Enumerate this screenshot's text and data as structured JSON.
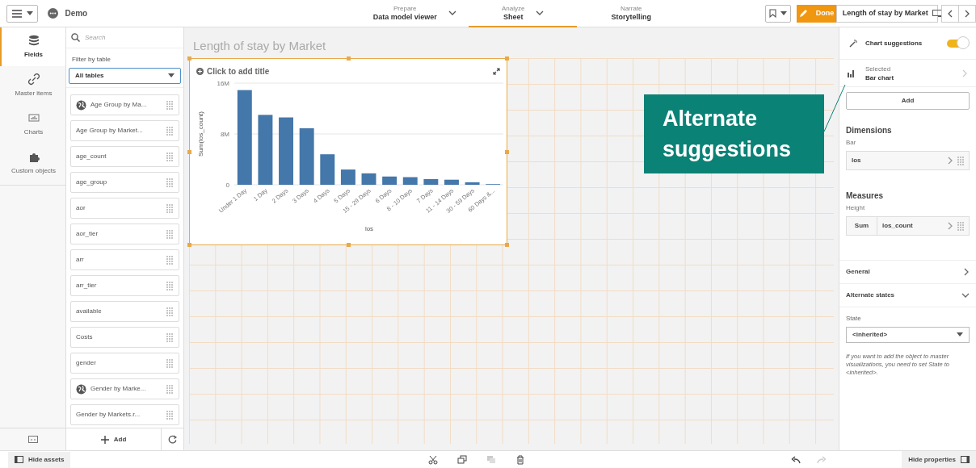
{
  "app": {
    "name": "Demo"
  },
  "nav_tabs": [
    {
      "stage": "Prepare",
      "label": "Data model viewer",
      "selected": false,
      "has_menu": true
    },
    {
      "stage": "Analyze",
      "label": "Sheet",
      "selected": true,
      "has_menu": true
    },
    {
      "stage": "Narrate",
      "label": "Storytelling",
      "selected": false,
      "has_menu": false
    }
  ],
  "toolbar": {
    "done": "Done",
    "sheet_title": "Length of stay by Market"
  },
  "asset_tabs": [
    {
      "label": "Fields",
      "kind": "fields",
      "selected": true
    },
    {
      "label": "Master items",
      "kind": "master",
      "selected": false
    },
    {
      "label": "Charts",
      "kind": "charts",
      "selected": false
    },
    {
      "label": "Custom objects",
      "kind": "custom",
      "selected": false
    }
  ],
  "fields_panel": {
    "search_placeholder": "Search",
    "filter_label": "Filter by table",
    "filter_value": "All tables",
    "fields": [
      {
        "label": "Age Group by Ma...",
        "kind": "geo"
      },
      {
        "label": "Age Group by Market...",
        "kind": "plain"
      },
      {
        "label": "age_count",
        "kind": "plain"
      },
      {
        "label": "age_group",
        "kind": "plain"
      },
      {
        "label": "aor",
        "kind": "plain"
      },
      {
        "label": "aor_tier",
        "kind": "plain"
      },
      {
        "label": "arr",
        "kind": "plain"
      },
      {
        "label": "arr_tier",
        "kind": "plain"
      },
      {
        "label": "available",
        "kind": "plain"
      },
      {
        "label": "Costs",
        "kind": "plain"
      },
      {
        "label": "gender",
        "kind": "plain"
      },
      {
        "label": "Gender by Marke...",
        "kind": "geo"
      },
      {
        "label": "Gender by Markets.r...",
        "kind": "plain"
      }
    ],
    "add": "Add"
  },
  "sheet": {
    "title": "Length of stay by Market",
    "chart_title_placeholder": "Click to add title",
    "chart_data": {
      "type": "bar",
      "xlabel": "los",
      "ylabel": "Sum(los_count)",
      "categories": [
        "Under 1 Day",
        "1 Day",
        "2 Days",
        "3 Days",
        "4 Days",
        "5 Days",
        "15 - 29 Days",
        "6 Days",
        "8 - 10 Days",
        "7 Days",
        "11 - 14 Days",
        "30 - 59 Days",
        "60 Days &..."
      ],
      "series": [
        {
          "color": "#4477aa",
          "values": [
            14.9,
            11.0,
            10.6,
            8.9,
            4.8,
            2.4,
            1.8,
            1.3,
            1.2,
            0.9,
            0.8,
            0.4,
            0.1
          ]
        }
      ],
      "ylim": [
        0,
        16
      ],
      "yticks": [
        {
          "value": 0,
          "label": "0"
        },
        {
          "value": 8,
          "label": "8M"
        },
        {
          "value": 16,
          "label": "16M"
        }
      ]
    }
  },
  "callout": "Alternate suggestions",
  "properties": {
    "chart_suggestions": {
      "label": "Chart suggestions",
      "on": true
    },
    "selected_caption": "Selected",
    "selected_chart": "Bar chart",
    "add": "Add",
    "dimensions": {
      "heading": "Dimensions",
      "sub": "Bar",
      "field": "los"
    },
    "measures": {
      "heading": "Measures",
      "sub": "Height",
      "aggregation": "Sum",
      "field": "los_count"
    },
    "sections": [
      {
        "label": "General",
        "expanded": false
      },
      {
        "label": "Alternate states",
        "expanded": true
      }
    ],
    "state_label": "State",
    "state_value": "<inherited>",
    "note": "If you want to add the object to master visualizations, you need to set State to <inherited>."
  },
  "footer": {
    "hide_assets": "Hide assets",
    "hide_properties": "Hide properties"
  }
}
